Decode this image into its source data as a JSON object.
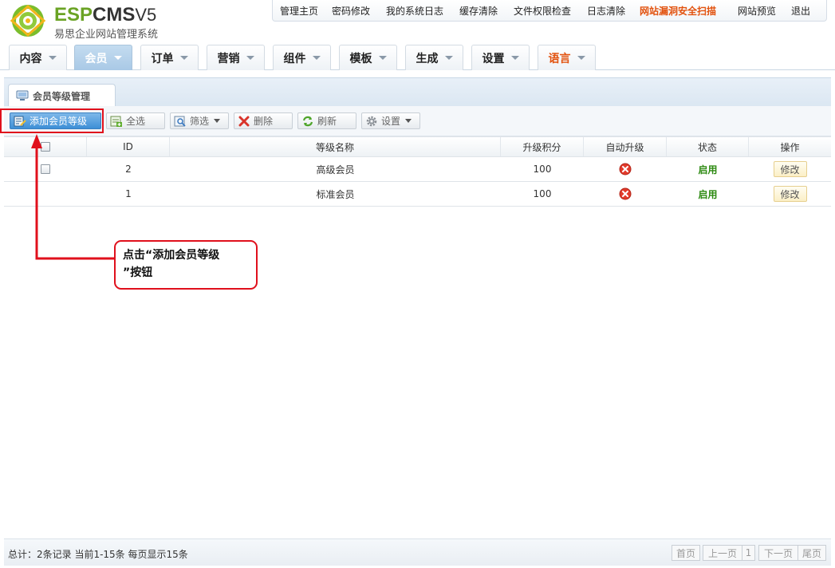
{
  "brand": {
    "name_esp": "ESP",
    "name_cms": "CMS",
    "version": "V5",
    "subtitle": "易思企业网站管理系统",
    "colors": {
      "green": "#6aa324",
      "accent_red": "#e0101c",
      "warn_orange": "#e2520e",
      "active_blue": "#a9c9e6"
    }
  },
  "topnav": [
    {
      "label": "管理主页"
    },
    {
      "label": "密码修改"
    },
    {
      "label": "我的系统日志"
    },
    {
      "label": "缓存清除"
    },
    {
      "label": "文件权限检查"
    },
    {
      "label": "日志清除"
    },
    {
      "label": "网站漏洞安全扫描"
    },
    {
      "label": "网站预览"
    },
    {
      "label": "退出"
    }
  ],
  "mainnav": [
    {
      "label": "内容"
    },
    {
      "label": "会员"
    },
    {
      "label": "订单"
    },
    {
      "label": "营销"
    },
    {
      "label": "组件"
    },
    {
      "label": "模板"
    },
    {
      "label": "生成"
    },
    {
      "label": "设置"
    },
    {
      "label": "语言"
    }
  ],
  "panel": {
    "title": "会员等级管理",
    "icon": "monitor-icon"
  },
  "toolbar": {
    "add": "添加会员等级",
    "select_all": "全选",
    "filter": "筛选",
    "delete": "删除",
    "refresh": "刷新",
    "settings": "设置"
  },
  "table": {
    "headers": [
      "ID",
      "等级名称",
      "升级积分",
      "自动升级",
      "状态",
      "操作"
    ],
    "rows": [
      {
        "id": "2",
        "name": "高级会员",
        "points": "100",
        "auto_upgrade": "no-icon",
        "status": "启用",
        "action": "修改"
      },
      {
        "id": "1",
        "name": "标准会员",
        "points": "100",
        "auto_upgrade": "no-icon",
        "status": "启用",
        "action": "修改"
      }
    ]
  },
  "annotation": {
    "line1": "点击“添加会员等级",
    "line2": "”按钮"
  },
  "footer": {
    "info": "总计：2条记录 当前1-15条 每页显示15条",
    "first": "首页",
    "prev": "上一页",
    "page": "1",
    "next": "下一页",
    "last": "尾页"
  }
}
